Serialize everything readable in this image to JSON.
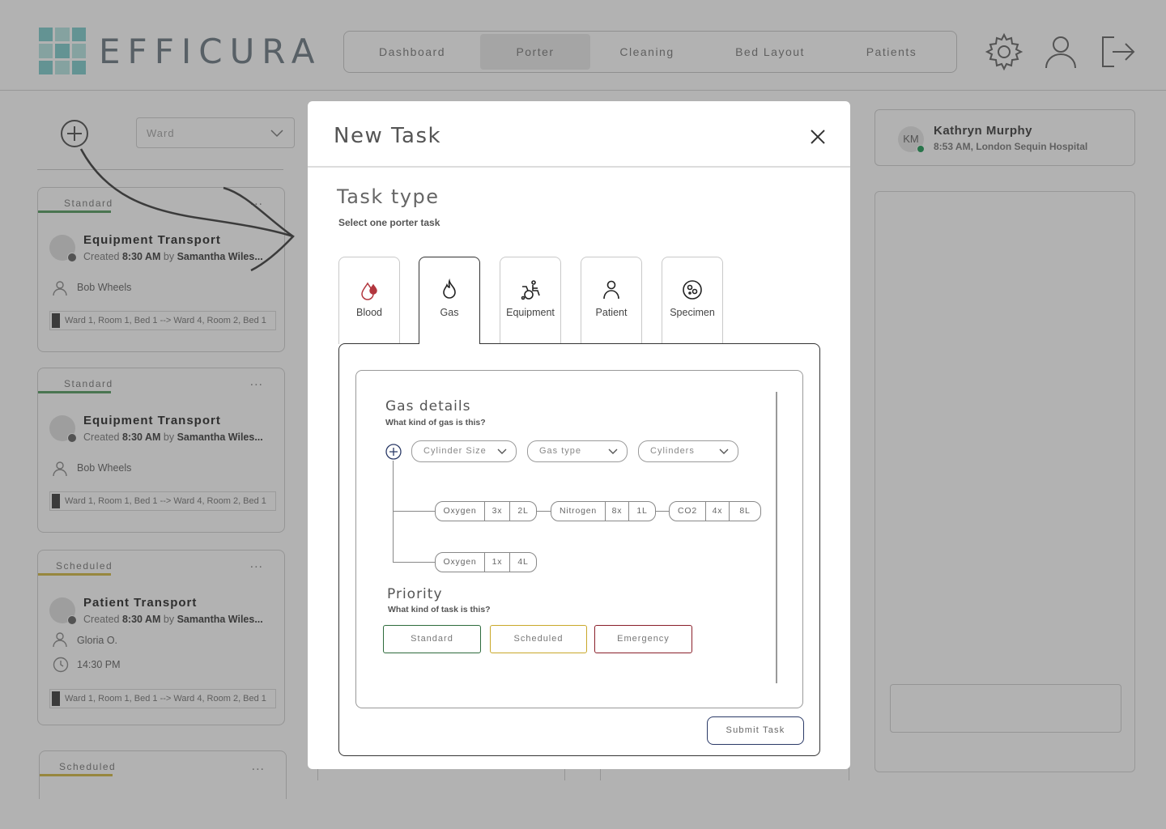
{
  "app": {
    "brand": "EFFICURA",
    "nav": [
      {
        "label": "Dashboard",
        "active": false
      },
      {
        "label": "Porter",
        "active": true
      },
      {
        "label": "Cleaning",
        "active": false
      },
      {
        "label": "Bed Layout",
        "active": false
      },
      {
        "label": "Patients",
        "active": false
      }
    ],
    "header_icons": [
      "gear-icon",
      "user-icon",
      "logout-icon"
    ],
    "ward_select": {
      "value": "Ward"
    }
  },
  "cards": [
    {
      "tag": "Standard",
      "tag_color": "#5aa86a",
      "title": "Equipment Transport",
      "created_prefix": "Created ",
      "time": "8:30 AM",
      "by": " by ",
      "creator": "Samantha Wiles...",
      "person": "Bob Wheels",
      "route": "Ward 1, Room 1, Bed 1  --> Ward 4, Room 2, Bed 1",
      "dots": "..."
    },
    {
      "tag": "Standard",
      "tag_color": "#5aa86a",
      "title": "Equipment Transport",
      "created_prefix": "Created ",
      "time": "8:30 AM",
      "by": " by ",
      "creator": "Samantha Wiles...",
      "person": "Bob Wheels",
      "route": "Ward 1, Room 1, Bed 1  --> Ward 4, Room 2, Bed 1",
      "dots": "..."
    },
    {
      "tag": "Scheduled",
      "tag_color": "#d6c04a",
      "title": "Patient Transport",
      "created_prefix": "Created ",
      "time": "8:30 AM",
      "by": " by ",
      "creator": "Samantha Wiles...",
      "person": "Gloria O.",
      "scheduled_time": "14:30 PM",
      "route": "Ward 1, Room 1, Bed 1  --> Ward 4, Room 2, Bed 1",
      "dots": "..."
    },
    {
      "tag": "Scheduled",
      "tag_color": "#d6c04a",
      "dots": "..."
    }
  ],
  "user": {
    "initials": "KM",
    "name": "Kathryn Murphy",
    "details": "8:53 AM, London Sequin Hospital",
    "status_color": "#3aa66a"
  },
  "modal": {
    "title": "New Task",
    "section_title": "Task type",
    "section_subtitle": "Select one porter task",
    "task_types": [
      {
        "label": "Blood",
        "icon": "blood-drop-icon",
        "active": false
      },
      {
        "label": "Gas",
        "icon": "flame-icon",
        "active": true
      },
      {
        "label": "Equipment",
        "icon": "wheelchair-icon",
        "active": false
      },
      {
        "label": "Patient",
        "icon": "person-icon",
        "active": false
      },
      {
        "label": "Specimen",
        "icon": "specimen-icon",
        "active": false
      }
    ],
    "gas": {
      "title": "Gas details",
      "subtitle": "What kind of gas is this?",
      "dropdowns": [
        {
          "placeholder": "Cylinder Size"
        },
        {
          "placeholder": "Gas type"
        },
        {
          "placeholder": "Cylinders"
        }
      ],
      "entries_row1": [
        {
          "gas": "Oxygen",
          "count": "3x",
          "size": "2L"
        },
        {
          "gas": "Nitrogen",
          "count": "8x",
          "size": "1L"
        },
        {
          "gas": "CO2",
          "count": "4x",
          "size": "8L"
        }
      ],
      "entries_row2": [
        {
          "gas": "Oxygen",
          "count": "1x",
          "size": "4L"
        }
      ]
    },
    "priority": {
      "title": "Priority",
      "subtitle": "What kind of task is this?",
      "options": [
        {
          "label": "Standard",
          "color": "#2e6b3c"
        },
        {
          "label": "Scheduled",
          "color": "#c9a82a"
        },
        {
          "label": "Emergency",
          "color": "#8a1f2a"
        }
      ]
    },
    "submit_label": "Submit Task"
  }
}
